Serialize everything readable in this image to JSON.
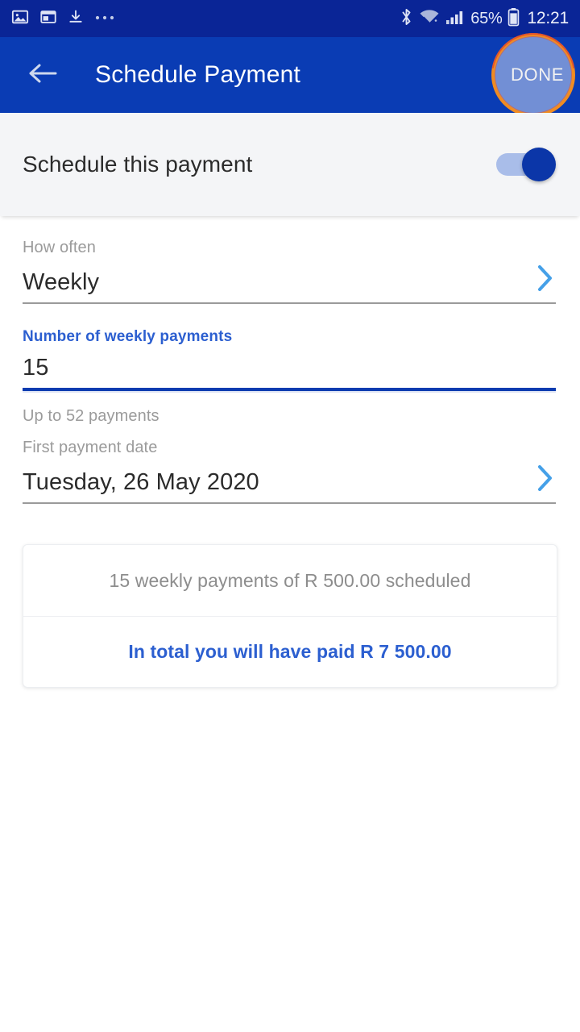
{
  "status_bar": {
    "left_icons": [
      "image-icon",
      "window-card-icon",
      "download-icon",
      "more-ellipsis-icon"
    ],
    "right_icons": [
      "bluetooth-icon",
      "wifi-icon",
      "signal-bars-icon",
      "battery-icon"
    ],
    "battery_percent": "65%",
    "time": "12:21",
    "background_color": "#0a2596"
  },
  "app_bar": {
    "back_icon": "back-arrow-icon",
    "title": "Schedule Payment",
    "done_label": "DONE",
    "background_color": "#0a3cb4",
    "touch_ring_color": "#f08c22"
  },
  "toggle_section": {
    "label": "Schedule this payment",
    "state": "on",
    "track_color": "#a9bde9",
    "thumb_color": "#0b36a8"
  },
  "form": {
    "how_often": {
      "label": "How often",
      "value": "Weekly",
      "chevron_icon": "chevron-right-icon",
      "focused": false
    },
    "number_of_payments": {
      "label": "Number of weekly payments",
      "value": "15",
      "helper": "Up to 52 payments",
      "focused": true,
      "label_color": "#2c5fd0",
      "underline_color": "#0b3bb0"
    },
    "first_payment_date": {
      "label": "First payment date",
      "value": "Tuesday, 26 May 2020",
      "chevron_icon": "chevron-right-icon",
      "focused": false
    }
  },
  "summary_card": {
    "scheduled_text": "15 weekly payments of R 500.00 scheduled",
    "total_text": "In total you will have paid R 7 500.00",
    "accent_color": "#2c5fd0"
  }
}
